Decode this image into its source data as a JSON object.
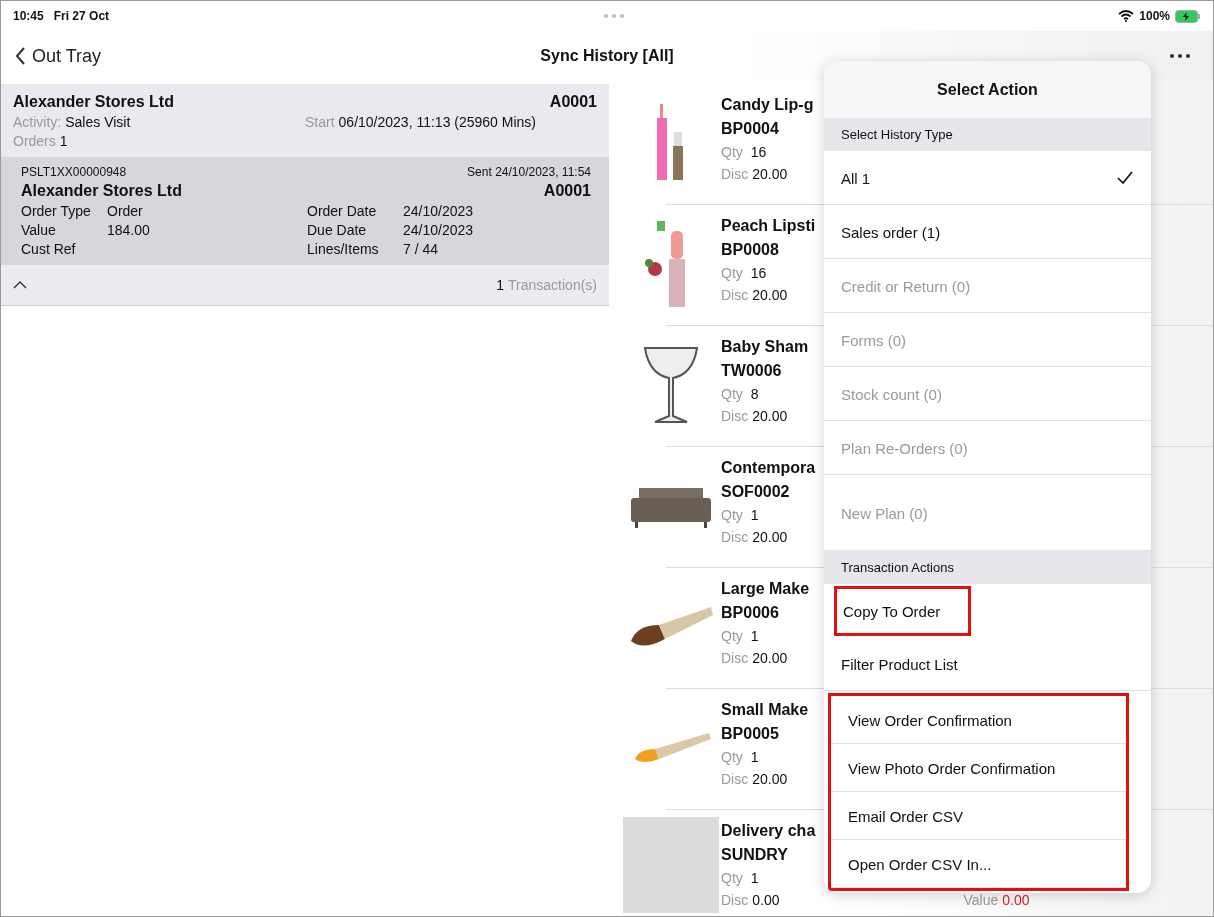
{
  "status_bar": {
    "time": "10:45",
    "date": "Fri 27 Oct",
    "battery": "100%"
  },
  "nav": {
    "back": "Out Tray",
    "title": "Sync History [All]"
  },
  "visit": {
    "customer": "Alexander Stores Ltd",
    "account": "A0001",
    "activity_label": "Activity:",
    "activity": "Sales Visit",
    "start_label": "Start",
    "start": "06/10/2023, 11:13 (25960 Mins)",
    "orders_label": "Orders",
    "orders": "1"
  },
  "order": {
    "reference": "PSLT1XX00000948",
    "sent": "Sent 24/10/2023, 11:54",
    "customer": "Alexander Stores Ltd",
    "account": "A0001",
    "fields": [
      {
        "label": "Order Type",
        "value": "Order"
      },
      {
        "label": "Order Date",
        "value": "24/10/2023"
      },
      {
        "label": "Value",
        "value": "184.00"
      },
      {
        "label": "Due Date",
        "value": "24/10/2023"
      },
      {
        "label": "Cust Ref"
      },
      {
        "label": "Lines/Items",
        "value": "7 / 44"
      }
    ]
  },
  "transactions": {
    "expanded": true,
    "count": "1",
    "label": "Transaction(s)"
  },
  "products": [
    {
      "kind": "lipgloss",
      "name": "Candy Lip-g",
      "code": "BP0004",
      "qty_label": "Qty",
      "qty": "16",
      "disc_label": "Disc",
      "disc": "20.00"
    },
    {
      "kind": "lipstick",
      "name": "Peach Lipsti",
      "code": "BP0008",
      "qty_label": "Qty",
      "qty": "16",
      "disc_label": "Disc",
      "disc": "20.00"
    },
    {
      "kind": "glass",
      "name": "Baby Sham",
      "code": "TW0006",
      "qty_label": "Qty",
      "qty": "8",
      "disc_label": "Disc",
      "disc": "20.00"
    },
    {
      "kind": "sofa",
      "name": "Contempora",
      "code": "SOF0002",
      "qty_label": "Qty",
      "qty": "1",
      "disc_label": "Disc",
      "disc": "20.00"
    },
    {
      "kind": "large-brush",
      "name": "Large Make",
      "code": "BP0006",
      "qty_label": "Qty",
      "qty": "1",
      "disc_label": "Disc",
      "disc": "20.00"
    },
    {
      "kind": "small-brush",
      "name": "Small Make",
      "code": "BP0005",
      "qty_label": "Qty",
      "qty": "1",
      "disc_label": "Disc",
      "disc": "20.00"
    },
    {
      "kind": "placeholder",
      "name": "Delivery cha",
      "code": "SUNDRY",
      "qty_label": "Qty",
      "qty": "1",
      "disc_label": "Disc",
      "disc": "0.00",
      "value_label": "Value",
      "value": "0.00"
    }
  ],
  "popover": {
    "title": "Select Action",
    "history_header": "Select History Type",
    "history_types": [
      {
        "label": "All 1",
        "selected": true,
        "disabled": false
      },
      {
        "label": "Sales order (1)",
        "selected": false,
        "disabled": false
      },
      {
        "label": "Credit or Return (0)",
        "selected": false,
        "disabled": true
      },
      {
        "label": "Forms (0)",
        "selected": false,
        "disabled": true
      },
      {
        "label": "Stock count (0)",
        "selected": false,
        "disabled": true
      },
      {
        "label": "Plan Re-Orders (0)",
        "selected": false,
        "disabled": true
      },
      {
        "label": "New Plan (0)",
        "selected": false,
        "disabled": true
      }
    ],
    "actions_header": "Transaction Actions",
    "actions": [
      {
        "label": "Copy To Order",
        "highlighted": true
      },
      {
        "label": "Filter Product List",
        "highlighted": false
      },
      {
        "label": "View Order Confirmation",
        "highlighted": true
      },
      {
        "label": "View Photo Order Confirmation",
        "highlighted": true
      },
      {
        "label": "Email Order CSV",
        "highlighted": true
      },
      {
        "label": "Open Order CSV In...",
        "highlighted": true
      }
    ]
  }
}
